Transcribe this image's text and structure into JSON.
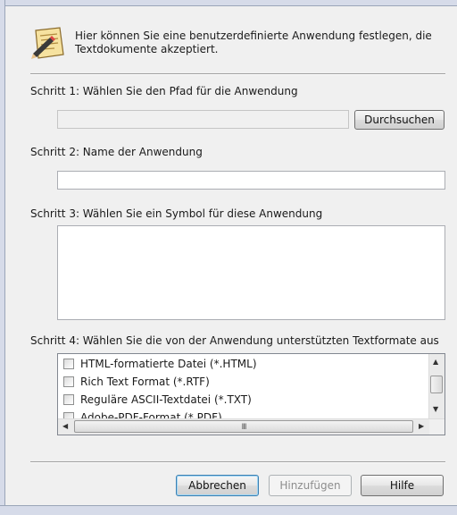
{
  "header": {
    "text": "Hier können Sie eine benutzerdefinierte Anwendung festlegen, die Textdokumente akzeptiert."
  },
  "step1": {
    "label": "Schritt 1: Wählen Sie den Pfad für die Anwendung",
    "path_value": "",
    "browse_label": "Durchsuchen"
  },
  "step2": {
    "label": "Schritt 2: Name der Anwendung",
    "name_value": ""
  },
  "step3": {
    "label": "Schritt 3: Wählen Sie ein Symbol für diese Anwendung"
  },
  "step4": {
    "label": "Schritt 4: Wählen Sie die von der Anwendung unterstützten Textformate aus",
    "formats": [
      {
        "label": "HTML-formatierte Datei (*.HTML)",
        "checked": false
      },
      {
        "label": "Rich Text Format (*.RTF)",
        "checked": false
      },
      {
        "label": "Reguläre ASCII-Textdatei (*.TXT)",
        "checked": false
      },
      {
        "label": "Adobe-PDF-Format (*.PDF)",
        "checked": false
      }
    ]
  },
  "buttons": {
    "cancel": "Abbrechen",
    "add": "Hinzufügen",
    "help": "Hilfe"
  },
  "icons": {
    "header": "document-pen-icon"
  }
}
